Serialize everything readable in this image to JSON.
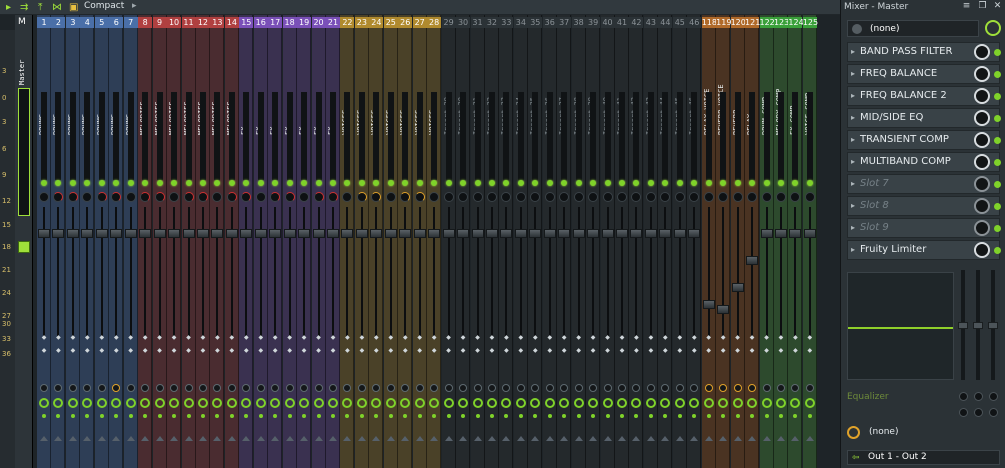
{
  "toolbar": {
    "view_label": "Compact",
    "icons": [
      "mixer-arrows-icon",
      "up-arrow-icon",
      "link-icon",
      "layout-icon"
    ]
  },
  "db_scale": [
    "3",
    "0",
    "3",
    "6",
    "9",
    "12",
    "15",
    "18",
    "21",
    "24",
    "27",
    "30",
    "33",
    "36"
  ],
  "master": {
    "header": "M",
    "name": "Master"
  },
  "colors": {
    "drums": "#4a6fa8",
    "melodies": "#a33b3b",
    "fx": "#6a4aa0",
    "voices": "#9a7a2a",
    "empty": "#2f3539",
    "sends": "#a86a2a",
    "comp": "#3a8a3a",
    "accent": "#9fe03a"
  },
  "strips": [
    {
      "num": "1",
      "name": "DRUMS",
      "group": "drums"
    },
    {
      "num": "2",
      "name": "DRUMS",
      "group": "drums"
    },
    {
      "num": "3",
      "name": "DRUMS",
      "group": "drums"
    },
    {
      "num": "4",
      "name": "DRUMS",
      "group": "drums"
    },
    {
      "num": "5",
      "name": "DRUMS",
      "group": "drums"
    },
    {
      "num": "6",
      "name": "DRUMS",
      "group": "drums"
    },
    {
      "num": "7",
      "name": "DRUMS",
      "group": "drums"
    },
    {
      "num": "8",
      "name": "MELODIES",
      "group": "melodies"
    },
    {
      "num": "9",
      "name": "MELODIES",
      "group": "melodies"
    },
    {
      "num": "10",
      "name": "MELODIES",
      "group": "melodies"
    },
    {
      "num": "11",
      "name": "MELODIES",
      "group": "melodies"
    },
    {
      "num": "12",
      "name": "MELODIES",
      "group": "melodies"
    },
    {
      "num": "13",
      "name": "MELODIES",
      "group": "melodies"
    },
    {
      "num": "14",
      "name": "MELODIES",
      "group": "melodies"
    },
    {
      "num": "15",
      "name": "FX",
      "group": "fx"
    },
    {
      "num": "16",
      "name": "FX",
      "group": "fx"
    },
    {
      "num": "17",
      "name": "FX",
      "group": "fx"
    },
    {
      "num": "18",
      "name": "FX",
      "group": "fx"
    },
    {
      "num": "19",
      "name": "FX",
      "group": "fx"
    },
    {
      "num": "20",
      "name": "FX",
      "group": "fx"
    },
    {
      "num": "21",
      "name": "FX",
      "group": "fx"
    },
    {
      "num": "22",
      "name": "VOICES",
      "group": "voices"
    },
    {
      "num": "23",
      "name": "VOICES",
      "group": "voices"
    },
    {
      "num": "24",
      "name": "VOICES",
      "group": "voices"
    },
    {
      "num": "25",
      "name": "VOICES",
      "group": "voices"
    },
    {
      "num": "26",
      "name": "VOICES",
      "group": "voices"
    },
    {
      "num": "27",
      "name": "VOICES",
      "group": "voices"
    },
    {
      "num": "28",
      "name": "VOICES",
      "group": "voices"
    },
    {
      "num": "29",
      "name": "Insert 29",
      "group": "empty"
    },
    {
      "num": "30",
      "name": "Insert 30",
      "group": "empty"
    },
    {
      "num": "31",
      "name": "Insert 31",
      "group": "empty"
    },
    {
      "num": "32",
      "name": "Insert 32",
      "group": "empty"
    },
    {
      "num": "33",
      "name": "Insert 33",
      "group": "empty"
    },
    {
      "num": "34",
      "name": "Insert 34",
      "group": "empty"
    },
    {
      "num": "35",
      "name": "Insert 35",
      "group": "empty"
    },
    {
      "num": "36",
      "name": "Insert 36",
      "group": "empty"
    },
    {
      "num": "37",
      "name": "Insert 37",
      "group": "empty"
    },
    {
      "num": "38",
      "name": "Insert 38",
      "group": "empty"
    },
    {
      "num": "39",
      "name": "Insert 39",
      "group": "empty"
    },
    {
      "num": "40",
      "name": "Insert 40",
      "group": "empty"
    },
    {
      "num": "41",
      "name": "Insert 41",
      "group": "empty"
    },
    {
      "num": "42",
      "name": "Insert 42",
      "group": "empty"
    },
    {
      "num": "43",
      "name": "Insert 43",
      "group": "empty"
    },
    {
      "num": "44",
      "name": "Insert 44",
      "group": "empty"
    },
    {
      "num": "45",
      "name": "Insert 45",
      "group": "empty"
    },
    {
      "num": "46",
      "name": "Insert 46",
      "group": "empty"
    },
    {
      "num": "118",
      "name": "DELAY VOICE",
      "group": "sends"
    },
    {
      "num": "119",
      "name": "REVERB VOICE",
      "group": "sends"
    },
    {
      "num": "120",
      "name": "REVERB",
      "group": "sends"
    },
    {
      "num": "121",
      "name": "DELAY",
      "group": "sends"
    },
    {
      "num": "122",
      "name": "DRUM COMP",
      "group": "comp"
    },
    {
      "num": "123",
      "name": "MELODY COMP",
      "group": "comp"
    },
    {
      "num": "124",
      "name": "FX COMP",
      "group": "comp"
    },
    {
      "num": "125",
      "name": "VOICE COMP",
      "group": "comp"
    }
  ],
  "panel": {
    "title": "Mixer - Master",
    "input_select": "(none)",
    "slots": [
      {
        "label": "BAND PASS FILTER",
        "empty": false
      },
      {
        "label": "FREQ BALANCE",
        "empty": false
      },
      {
        "label": "FREQ BALANCE 2",
        "empty": false
      },
      {
        "label": "MID/SIDE EQ",
        "empty": false
      },
      {
        "label": "TRANSIENT COMP",
        "empty": false
      },
      {
        "label": "MULTIBAND COMP",
        "empty": false
      },
      {
        "label": "Slot 7",
        "empty": true
      },
      {
        "label": "Slot 8",
        "empty": true
      },
      {
        "label": "Slot 9",
        "empty": true
      },
      {
        "label": "Fruity Limiter",
        "empty": false
      }
    ],
    "eq_label": "Equalizer",
    "send_label": "(none)",
    "output_label": "Out 1 - Out 2"
  }
}
